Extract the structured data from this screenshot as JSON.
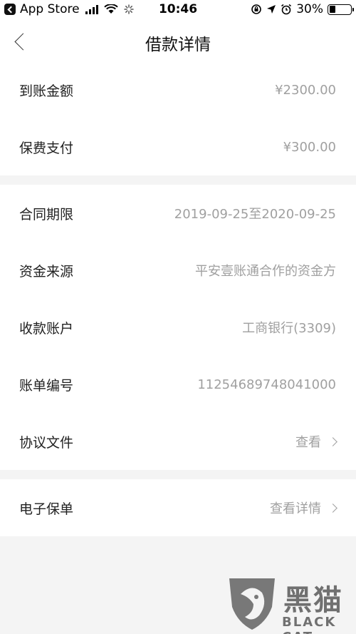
{
  "status_bar": {
    "back_app": "App Store",
    "time": "10:46",
    "battery": "30%",
    "battery_level": 0.3
  },
  "nav": {
    "title": "借款详情"
  },
  "section1": [
    {
      "label": "到账金额",
      "value": "¥2300.00"
    },
    {
      "label": "保费支付",
      "value": "¥300.00"
    }
  ],
  "section2": [
    {
      "label": "合同期限",
      "value": "2019-09-25至2020-09-25"
    },
    {
      "label": "资金来源",
      "value": "平安壹账通合作的资金方"
    },
    {
      "label": "收款账户",
      "value": "工商银行(3309)"
    },
    {
      "label": "账单编号",
      "value": "11254689748041000"
    },
    {
      "label": "协议文件",
      "value": "查看"
    }
  ],
  "section3": [
    {
      "label": "电子保单",
      "value": "查看详情"
    }
  ],
  "watermark": {
    "main": "黑猫",
    "sub": "BLACK CAT"
  }
}
